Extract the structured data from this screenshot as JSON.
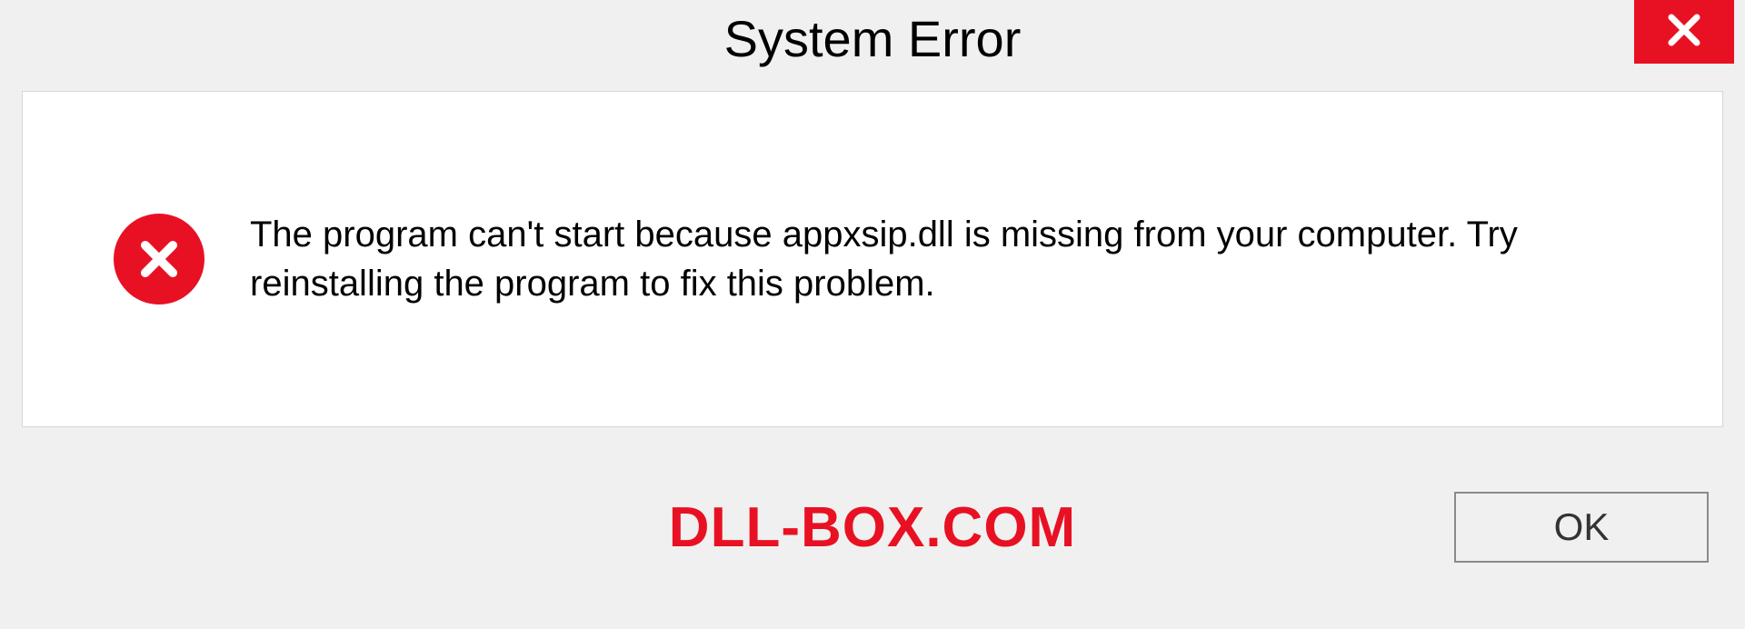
{
  "dialog": {
    "title": "System Error",
    "message": "The program can't start because appxsip.dll is missing from your computer. Try reinstalling the program to fix this problem.",
    "ok_label": "OK"
  },
  "watermark": "DLL-BOX.COM",
  "colors": {
    "error_red": "#e81123",
    "background": "#f0f0f0",
    "panel": "#ffffff"
  }
}
